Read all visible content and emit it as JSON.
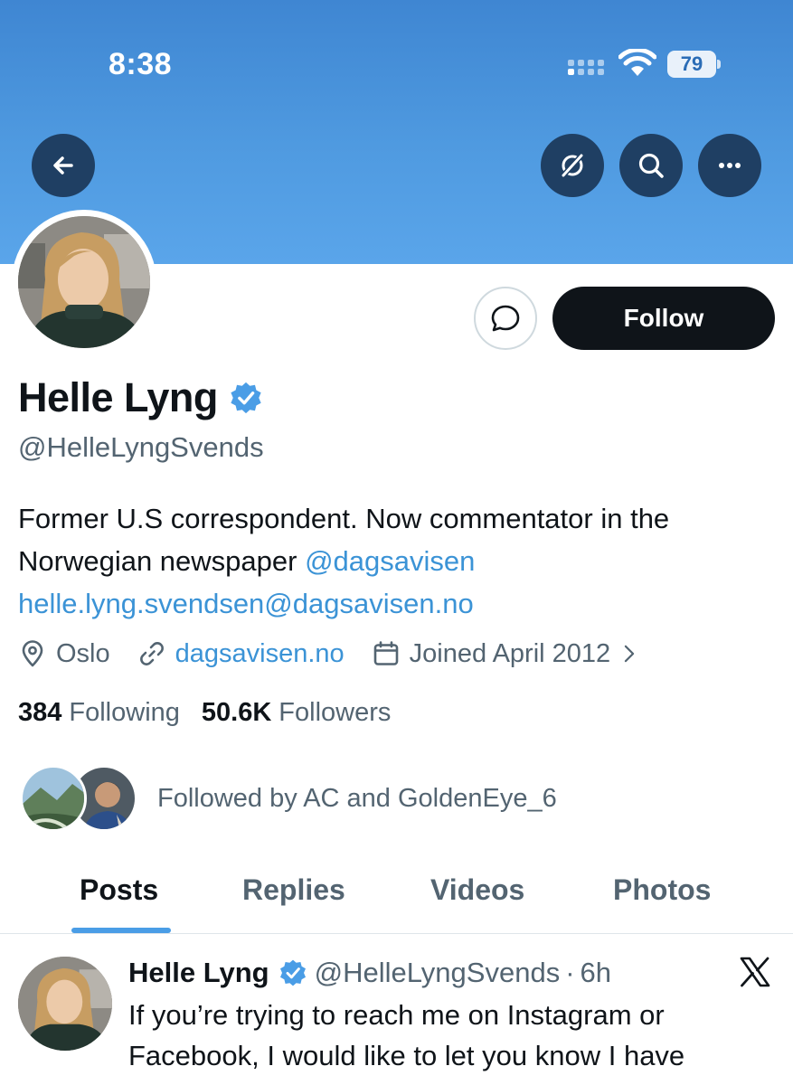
{
  "status_bar": {
    "time": "8:38",
    "battery": "79"
  },
  "colors": {
    "banner": "#4f9ae0",
    "follow_button": "#0f1419",
    "link": "#3b93d6",
    "verified": "#4a9de6"
  },
  "header_buttons": {
    "back_icon": "arrow-left-icon",
    "grok_icon": "grok-icon",
    "search_icon": "search-icon",
    "more_icon": "ellipsis-icon"
  },
  "profile": {
    "name": "Helle Lyng",
    "handle": "@HelleLyngSvends",
    "follow_label": "Follow",
    "bio_text": "Former U.S correspondent. Now commentator in the Norwegian newspaper ",
    "bio_mention": "@dagsavisen",
    "bio_email": "helle.lyng.svendsen@dagsavisen.no",
    "location": "Oslo",
    "website": "dagsavisen.no",
    "joined": "Joined April 2012"
  },
  "stats": {
    "following_count": "384",
    "following_label": "Following",
    "followers_count": "50.6K",
    "followers_label": "Followers"
  },
  "followed_by": "Followed by AC and GoldenEye_6",
  "tabs": [
    {
      "label": "Posts"
    },
    {
      "label": "Replies"
    },
    {
      "label": "Videos"
    },
    {
      "label": "Photos"
    }
  ],
  "post": {
    "name": "Helle Lyng",
    "handle": "@HelleLyngSvends",
    "separator": "·",
    "time": "6h",
    "text": "If you’re trying to reach me on Instagram or Facebook, I would like to let you know I have"
  }
}
